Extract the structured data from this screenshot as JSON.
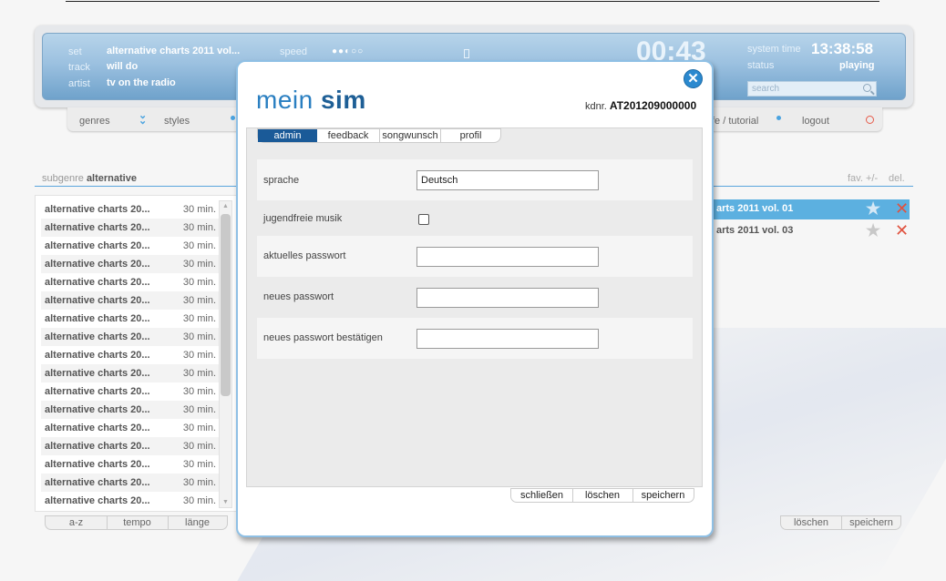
{
  "player": {
    "set_label": "set",
    "set_value": "alternative charts 2011 vol...",
    "track_label": "track",
    "track_value": "will do",
    "artist_label": "artist",
    "artist_value": "tv on the radio",
    "speed_label": "speed",
    "speed_dots": "●●◐○○",
    "timer": "00:43",
    "system_time_label": "system time",
    "system_time": "13:38:58",
    "status_label": "status",
    "status_value": "playing",
    "search_placeholder": "search"
  },
  "nav": {
    "genres": "genres",
    "styles": "styles",
    "help": "hilfe / tutorial",
    "logout": "logout"
  },
  "left_panel": {
    "subgenre_label": "subgenre",
    "subgenre_value": "alternative",
    "rows": [
      {
        "title": "alternative charts 20...",
        "duration": "30 min."
      },
      {
        "title": "alternative charts 20...",
        "duration": "30 min."
      },
      {
        "title": "alternative charts 20...",
        "duration": "30 min."
      },
      {
        "title": "alternative charts 20...",
        "duration": "30 min."
      },
      {
        "title": "alternative charts 20...",
        "duration": "30 min."
      },
      {
        "title": "alternative charts 20...",
        "duration": "30 min."
      },
      {
        "title": "alternative charts 20...",
        "duration": "30 min."
      },
      {
        "title": "alternative charts 20...",
        "duration": "30 min."
      },
      {
        "title": "alternative charts 20...",
        "duration": "30 min."
      },
      {
        "title": "alternative charts 20...",
        "duration": "30 min."
      },
      {
        "title": "alternative charts 20...",
        "duration": "30 min."
      },
      {
        "title": "alternative charts 20...",
        "duration": "30 min."
      },
      {
        "title": "alternative charts 20...",
        "duration": "30 min."
      },
      {
        "title": "alternative charts 20...",
        "duration": "30 min."
      },
      {
        "title": "alternative charts 20...",
        "duration": "30 min."
      },
      {
        "title": "alternative charts 20...",
        "duration": "30 min."
      },
      {
        "title": "alternative charts 20...",
        "duration": "30 min."
      }
    ],
    "sort_buttons": [
      "a-z",
      "tempo",
      "länge"
    ]
  },
  "right_panel": {
    "fav_label": "fav. +/-",
    "del_label": "del.",
    "rows": [
      {
        "title": "arts 2011 vol. 01",
        "selected": true
      },
      {
        "title": "arts 2011 vol. 03",
        "selected": false
      }
    ],
    "buttons": [
      "löschen",
      "speichern"
    ]
  },
  "modal": {
    "logo_light": "mein",
    "logo_bold": "sim",
    "kdnr_label": "kdnr.",
    "kdnr_value": "AT201209000000",
    "tabs": [
      "admin",
      "feedback",
      "songwunsch",
      "profil"
    ],
    "fields": {
      "language_label": "sprache",
      "language_value": "Deutsch",
      "youth_label": "jugendfreie musik",
      "current_pw_label": "aktuelles passwort",
      "new_pw_label": "neues passwort",
      "confirm_pw_label": "neues passwort bestätigen"
    },
    "buttons": [
      "schließen",
      "löschen",
      "speichern"
    ]
  },
  "colors": {
    "accent": "#2b89cf",
    "active_tab": "#1a5a98",
    "selected_row": "#5cb0e0",
    "delete": "#e0523f"
  }
}
